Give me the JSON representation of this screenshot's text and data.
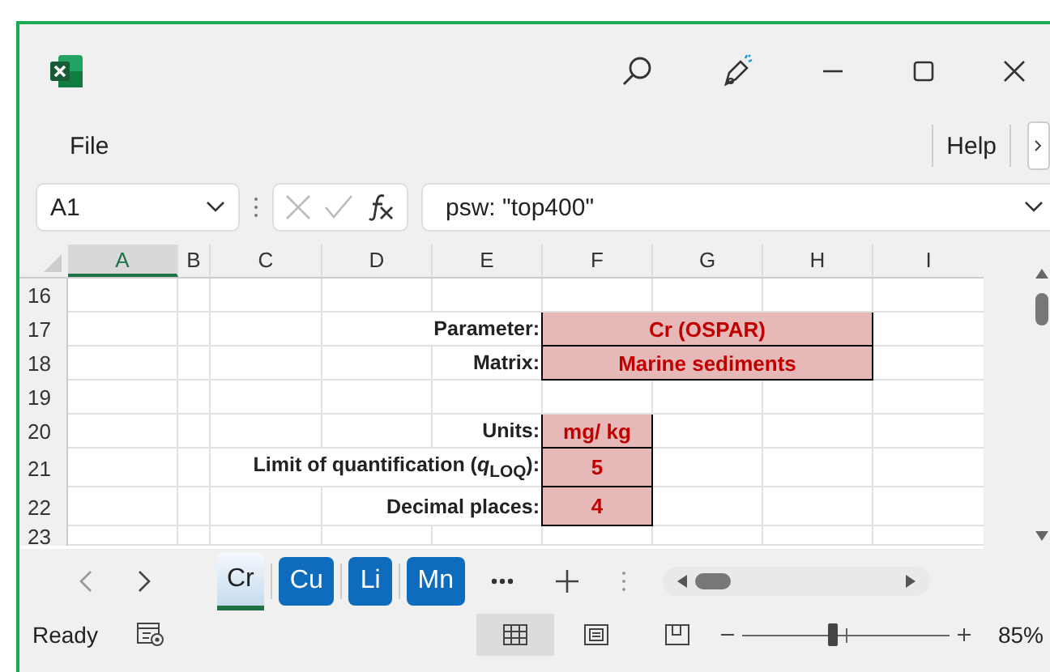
{
  "menu": {
    "items": [
      "File",
      "Help"
    ]
  },
  "formula_bar": {
    "name_box": "A1",
    "formula": "psw: \"top400\""
  },
  "columns": [
    {
      "label": "A",
      "selected": true
    },
    {
      "label": "B",
      "selected": false
    },
    {
      "label": "C",
      "selected": false
    },
    {
      "label": "D",
      "selected": false
    },
    {
      "label": "E",
      "selected": false
    },
    {
      "label": "F",
      "selected": false
    },
    {
      "label": "G",
      "selected": false
    },
    {
      "label": "H",
      "selected": false
    },
    {
      "label": "I",
      "selected": false
    }
  ],
  "rows": [
    {
      "number": "16",
      "cells": []
    },
    {
      "number": "17",
      "cells": [
        {
          "kind": "label",
          "text": "Parameter:"
        },
        {
          "kind": "value",
          "text": "Cr (OSPAR)",
          "merged": true
        }
      ]
    },
    {
      "number": "18",
      "cells": [
        {
          "kind": "label",
          "text": "Matrix:"
        },
        {
          "kind": "value",
          "text": "Marine sediments",
          "merged": true
        }
      ]
    },
    {
      "number": "19",
      "cells": []
    },
    {
      "number": "20",
      "cells": [
        {
          "kind": "label",
          "text": "Units:"
        },
        {
          "kind": "value",
          "text": "mg/ kg",
          "merged": false
        }
      ]
    },
    {
      "number": "21",
      "cells": [
        {
          "kind": "label",
          "text": "Limit of quantification (*q*$_{LOQ}$):"
        },
        {
          "kind": "value",
          "text": "5",
          "merged": false
        }
      ]
    },
    {
      "number": "22",
      "cells": [
        {
          "kind": "label",
          "text": "Decimal places:"
        },
        {
          "kind": "value",
          "text": "4",
          "merged": false
        }
      ]
    },
    {
      "number": "23",
      "cells": []
    }
  ],
  "sheet_tabs": [
    {
      "label": "Cr",
      "selected": true
    },
    {
      "label": "Cu",
      "selected": false
    },
    {
      "label": "Li",
      "selected": false
    },
    {
      "label": "Mn",
      "selected": false
    }
  ],
  "status_bar": {
    "text": "Ready",
    "views": [
      {
        "kind": "normal",
        "selected": true
      },
      {
        "kind": "page_layout",
        "selected": false
      },
      {
        "kind": "page_break",
        "selected": false
      }
    ],
    "zoom": {
      "level": 0.44,
      "reading": "85%"
    }
  }
}
